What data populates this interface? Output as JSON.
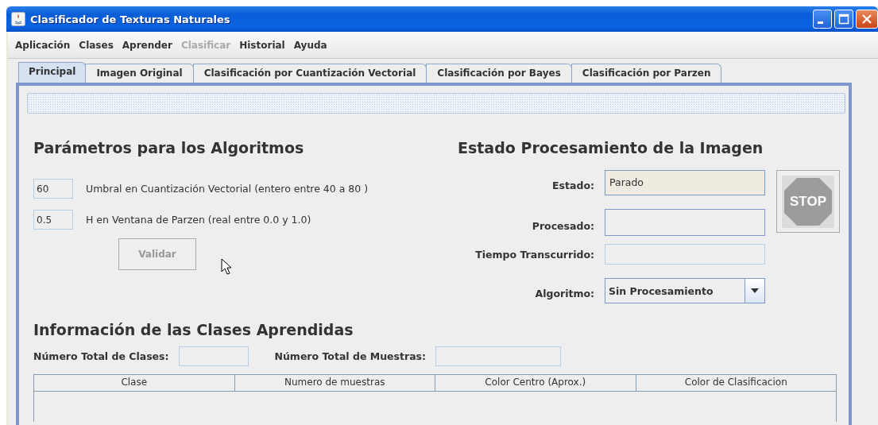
{
  "window": {
    "title": "Clasificador de Texturas Naturales"
  },
  "menu": [
    {
      "label": "Aplicación",
      "disabled": false
    },
    {
      "label": "Clases",
      "disabled": false
    },
    {
      "label": "Aprender",
      "disabled": false
    },
    {
      "label": "Clasificar",
      "disabled": true
    },
    {
      "label": "Historial",
      "disabled": false
    },
    {
      "label": "Ayuda",
      "disabled": false
    }
  ],
  "tabs": [
    {
      "label": "Principal",
      "selected": true
    },
    {
      "label": "Imagen Original",
      "selected": false
    },
    {
      "label": "Clasificación por Cuantización Vectorial",
      "selected": false
    },
    {
      "label": "Clasificación por Bayes",
      "selected": false
    },
    {
      "label": "Clasificación por Parzen",
      "selected": false
    }
  ],
  "parameters": {
    "heading": "Parámetros para los Algoritmos",
    "fields": [
      {
        "value": "60",
        "label": "Umbral en Cuantización Vectorial (entero entre 40 a 80 )"
      },
      {
        "value": "0.5",
        "label": "H en Ventana de Parzen (real entre 0.0 y 1.0)"
      }
    ],
    "button": {
      "label": "Validar",
      "disabled": true
    }
  },
  "status": {
    "heading": "Estado Procesamiento de la Imagen",
    "rows": [
      {
        "kind": "status",
        "label": "Estado:",
        "value": "Parado"
      },
      {
        "kind": "text",
        "label": "Procesado:"
      },
      {
        "kind": "disabled",
        "label": "Tiempo Transcurrido:"
      },
      {
        "kind": "combo",
        "label": "Algoritmo:",
        "value": "Sin Procesamiento"
      }
    ],
    "stop_button": {
      "label": "STOP",
      "disabled": true
    }
  },
  "classes": {
    "heading": "Información de las Clases Aprendidas",
    "totals": [
      {
        "label": "Número Total de Clases:"
      },
      {
        "label": "Número Total de Muestras:"
      }
    ],
    "table": {
      "columns": [
        "Clase",
        "Numero de muestras",
        "Color Centro (Aprox.)",
        "Color de Clasificacion"
      ]
    }
  }
}
